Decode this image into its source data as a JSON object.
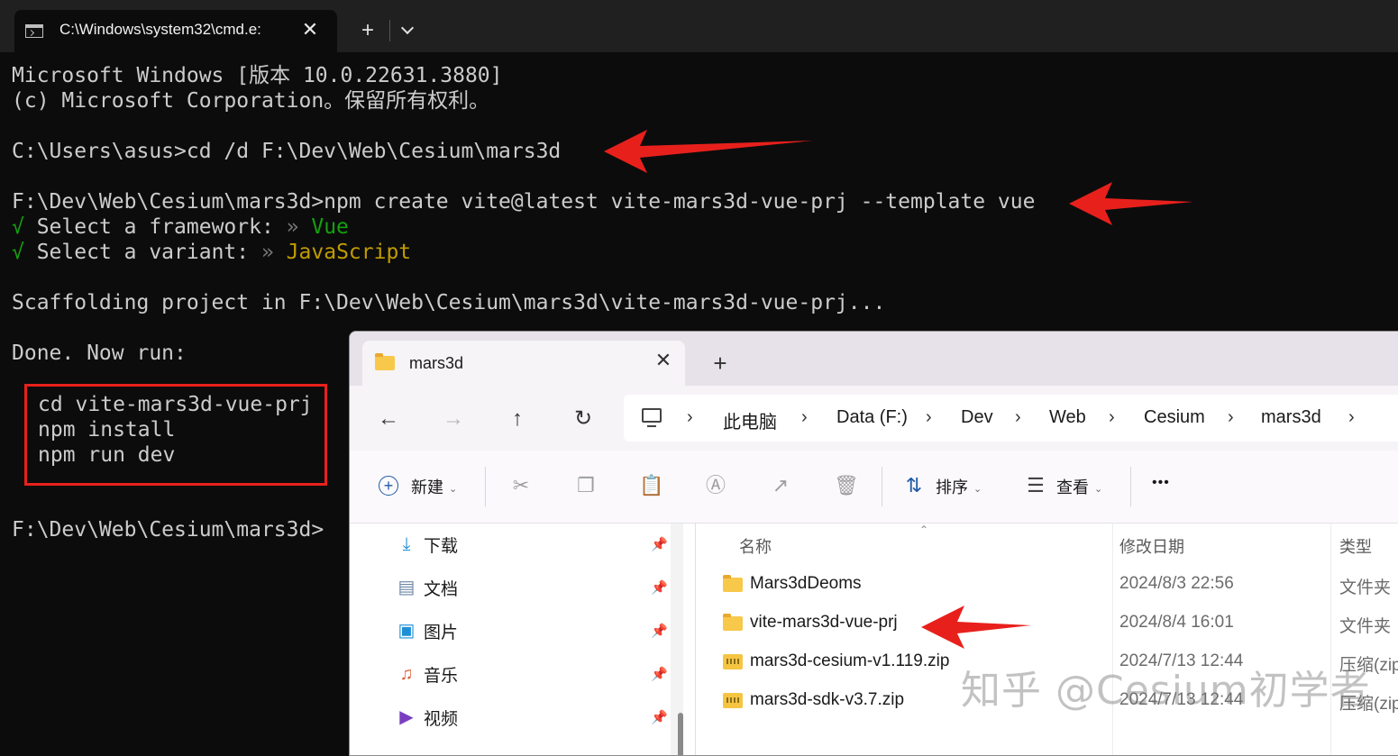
{
  "terminal": {
    "tab_title": "C:\\Windows\\system32\\cmd.e:",
    "new_tab_symbol": "+",
    "lines": {
      "l1": "Microsoft Windows [版本 10.0.22631.3880]",
      "l2": "(c) Microsoft Corporation。保留所有权利。",
      "l3": "C:\\Users\\asus>cd /d F:\\Dev\\Web\\Cesium\\mars3d",
      "l4": "F:\\Dev\\Web\\Cesium\\mars3d>npm create vite@latest vite-mars3d-vue-prj --template vue",
      "l5_check": "√",
      "l5_text": " Select a framework: ",
      "l5_sep": "»",
      "l5_value": " Vue",
      "l6_check": "√",
      "l6_text": " Select a variant: ",
      "l6_sep": "»",
      "l6_value": " JavaScript",
      "l7": "Scaffolding project in F:\\Dev\\Web\\Cesium\\mars3d\\vite-mars3d-vue-prj...",
      "l8": "Done. Now run:",
      "cmd1": "cd vite-mars3d-vue-prj",
      "cmd2": "npm install",
      "cmd3": "npm run dev",
      "prompt": "F:\\Dev\\Web\\Cesium\\mars3d>"
    }
  },
  "explorer": {
    "tab_title": "mars3d",
    "new_tab_symbol": "+",
    "breadcrumb": [
      "此电脑",
      "Data (F:)",
      "Dev",
      "Web",
      "Cesium",
      "mars3d"
    ],
    "toolbar": {
      "new_label": "新建",
      "sort_label": "排序",
      "view_label": "查看",
      "more_label": "•••"
    },
    "nav_items": [
      {
        "label": "下载"
      },
      {
        "label": "文档"
      },
      {
        "label": "图片"
      },
      {
        "label": "音乐"
      },
      {
        "label": "视频"
      }
    ],
    "columns": {
      "name": "名称",
      "date": "修改日期",
      "type": "类型"
    },
    "files": [
      {
        "name": "Mars3dDeoms",
        "date": "2024/8/3 22:56",
        "type": "文件夹"
      },
      {
        "name": "vite-mars3d-vue-prj",
        "date": "2024/8/4 16:01",
        "type": "文件夹"
      },
      {
        "name": "mars3d-cesium-v1.119.zip",
        "date": "2024/7/13 12:44",
        "type": "压缩(zip"
      },
      {
        "name": "mars3d-sdk-v3.7.zip",
        "date": "2024/7/13 12:44",
        "type": "压缩(zip"
      }
    ]
  },
  "watermark": "知乎 @Cesium初学者",
  "colors": {
    "terminal_bg": "#0c0c0c",
    "terminal_text": "#cccccc",
    "success_green": "#13a10e",
    "variant_yellow": "#c19c00",
    "annotation_red": "#e8201c"
  }
}
